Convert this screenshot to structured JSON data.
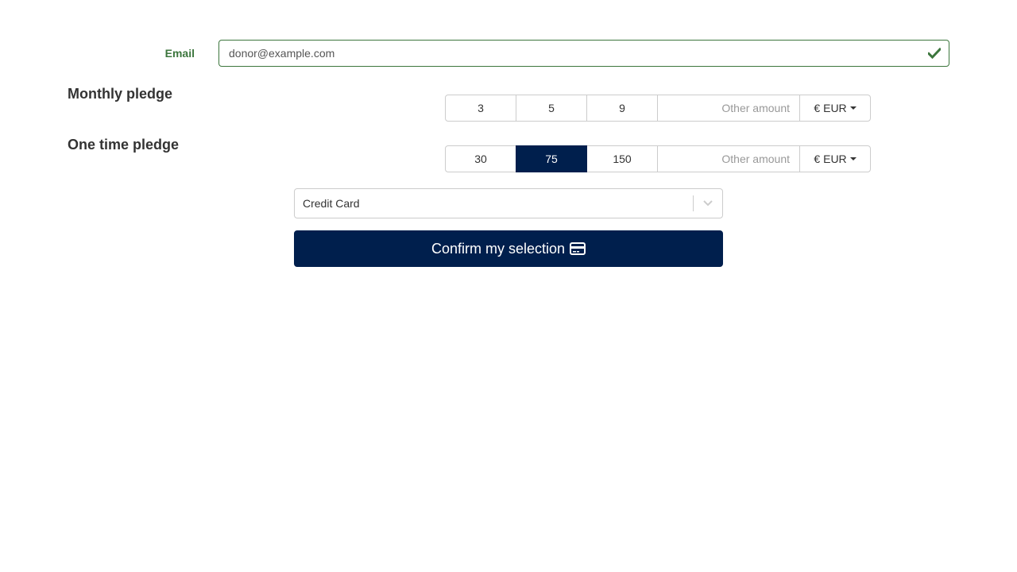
{
  "email": {
    "label": "Email",
    "value": "donor@example.com",
    "status_icon": "check-icon",
    "valid_color": "#3c763d"
  },
  "monthly": {
    "title": "Monthly pledge",
    "amounts": [
      "3",
      "5",
      "9"
    ],
    "selected": null,
    "other_placeholder": "Other amount",
    "currency_symbol": "€",
    "currency_code": "EUR"
  },
  "onetime": {
    "title": "One time pledge",
    "amounts": [
      "30",
      "75",
      "150"
    ],
    "selected": "75",
    "other_placeholder": "Other amount",
    "currency_symbol": "€",
    "currency_code": "EUR"
  },
  "payment": {
    "selected": "Credit Card"
  },
  "confirm": {
    "label": "Confirm my selection",
    "icon": "credit-card-icon"
  },
  "colors": {
    "primary": "#001f4d",
    "success": "#3c763d",
    "border": "#cccccc"
  }
}
